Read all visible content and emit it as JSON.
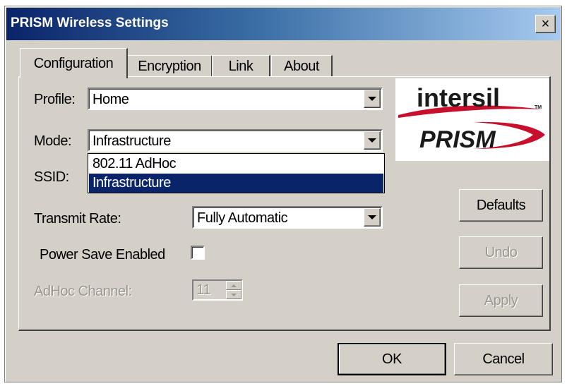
{
  "window": {
    "title": "PRISM Wireless Settings",
    "close_glyph": "×"
  },
  "tabs": [
    {
      "label": "Configuration",
      "active": true
    },
    {
      "label": "Encryption",
      "active": false
    },
    {
      "label": "Link",
      "active": false
    },
    {
      "label": "About",
      "active": false
    }
  ],
  "config": {
    "profile_label": "Profile:",
    "profile_value": "Home",
    "mode_label": "Mode:",
    "mode_value": "Infrastructure",
    "mode_options": [
      "802.11 AdHoc",
      "Infrastructure"
    ],
    "mode_highlighted": "Infrastructure",
    "ssid_label": "SSID:",
    "transmit_label": "Transmit Rate:",
    "transmit_value": "Fully Automatic",
    "power_save_label": "Power Save Enabled",
    "power_save_checked": false,
    "adhoc_channel_label": "AdHoc Channel:",
    "adhoc_channel_value": "11"
  },
  "logo": {
    "brand_top": "intersil",
    "brand_bottom": "PRISM",
    "tm": "TM",
    "accent_color": "#c8102e",
    "dark_color": "#1a1a1a"
  },
  "side_buttons": {
    "defaults": "Defaults",
    "undo": "Undo",
    "apply": "Apply"
  },
  "footer_buttons": {
    "ok": "OK",
    "cancel": "Cancel"
  },
  "colors": {
    "face": "#d4d0c8",
    "selection": "#0a246a",
    "title_start": "#0a246a",
    "title_end": "#a6caf0"
  }
}
